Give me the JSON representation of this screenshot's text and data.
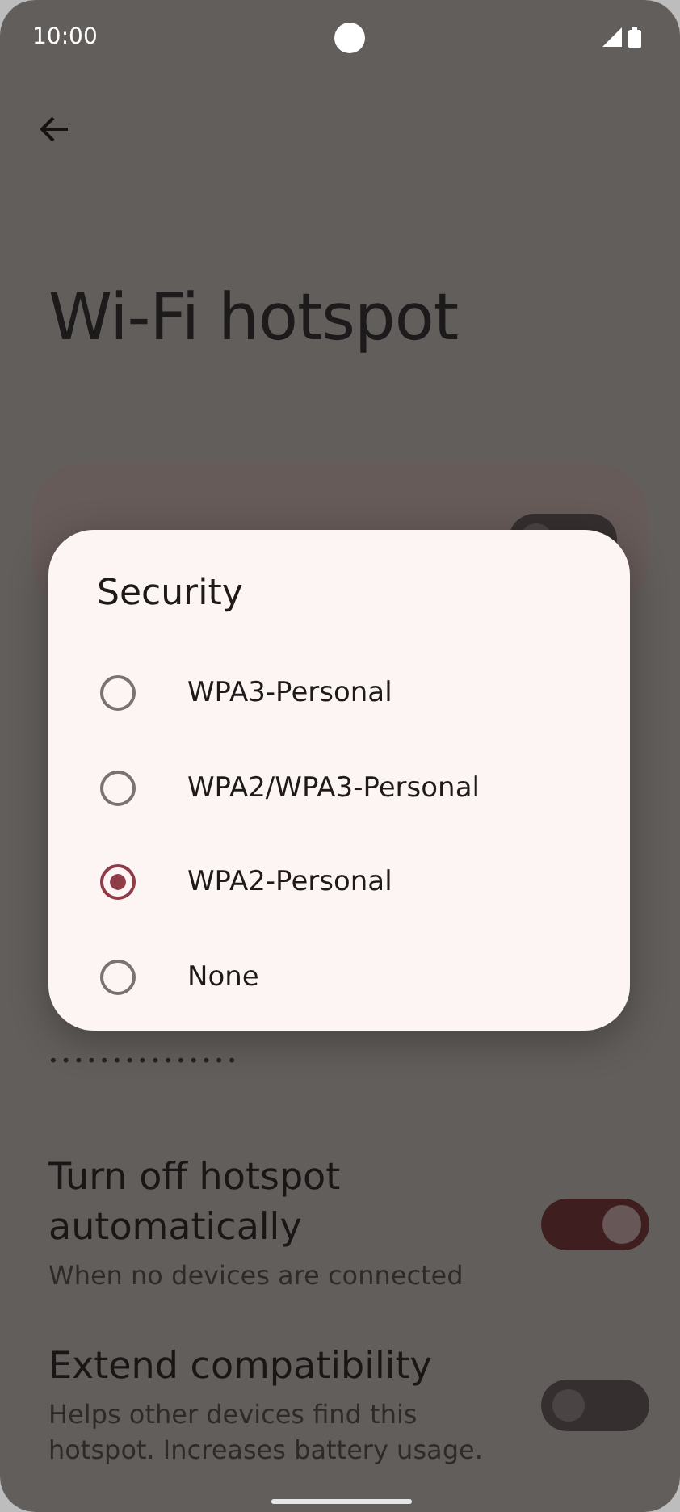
{
  "status_bar": {
    "time": "10:00"
  },
  "title": "Wi-Fi hotspot",
  "main_switch": {
    "on": false
  },
  "password": {
    "value": "•••••••••••••••"
  },
  "settings": [
    {
      "title": "Turn off hotspot automatically",
      "subtitle": "When no devices are connected",
      "on": true
    },
    {
      "title": "Extend compatibility",
      "subtitle": "Helps other devices find this hotspot. Increases battery usage.",
      "on": false
    }
  ],
  "dialog": {
    "title": "Security",
    "options": [
      {
        "label": "WPA3-Personal",
        "selected": false
      },
      {
        "label": "WPA2/WPA3-Personal",
        "selected": false
      },
      {
        "label": "WPA2-Personal",
        "selected": true
      },
      {
        "label": "None",
        "selected": false
      }
    ]
  }
}
